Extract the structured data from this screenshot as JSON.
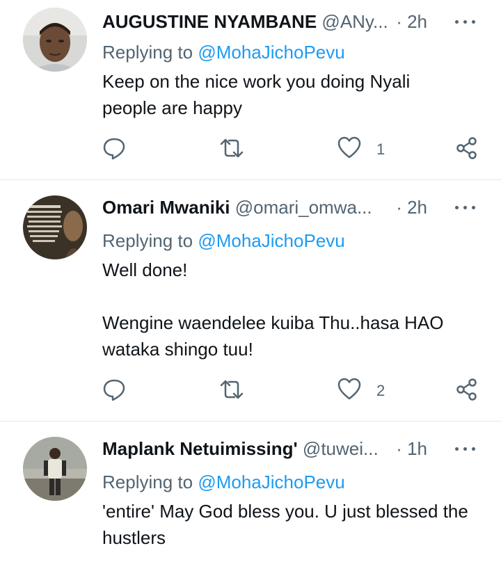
{
  "replies": [
    {
      "name": "AUGUSTINE NYAMBANE",
      "handle": "@ANy...",
      "time": "· 2h",
      "replying_prefix": "Replying to",
      "replying_to": "@MohaJichoPevu",
      "text": "Keep on the nice work you doing Nyali people are happy",
      "like_count": "1"
    },
    {
      "name": "Omari Mwaniki",
      "handle": "@omari_omwa...",
      "time": "· 2h",
      "replying_prefix": "Replying to",
      "replying_to": "@MohaJichoPevu",
      "text": "Well done!\n\nWengine waendelee kuiba Thu..hasa HAO wataka shingo tuu!",
      "like_count": "2"
    },
    {
      "name": "Maplank Netuimissing'",
      "handle": "@tuwei...",
      "time": "· 1h",
      "replying_prefix": "Replying to",
      "replying_to": "@MohaJichoPevu",
      "text": "'entire' May God bless you. U just blessed the hustlers"
    }
  ],
  "icons": {
    "reply": "reply-icon",
    "retweet": "retweet-icon",
    "like": "heart-icon",
    "share": "share-icon",
    "more": "more-icon"
  },
  "colors": {
    "mention": "#1d9bf0",
    "secondary_text": "#536471",
    "divider": "#e1e6ea"
  }
}
